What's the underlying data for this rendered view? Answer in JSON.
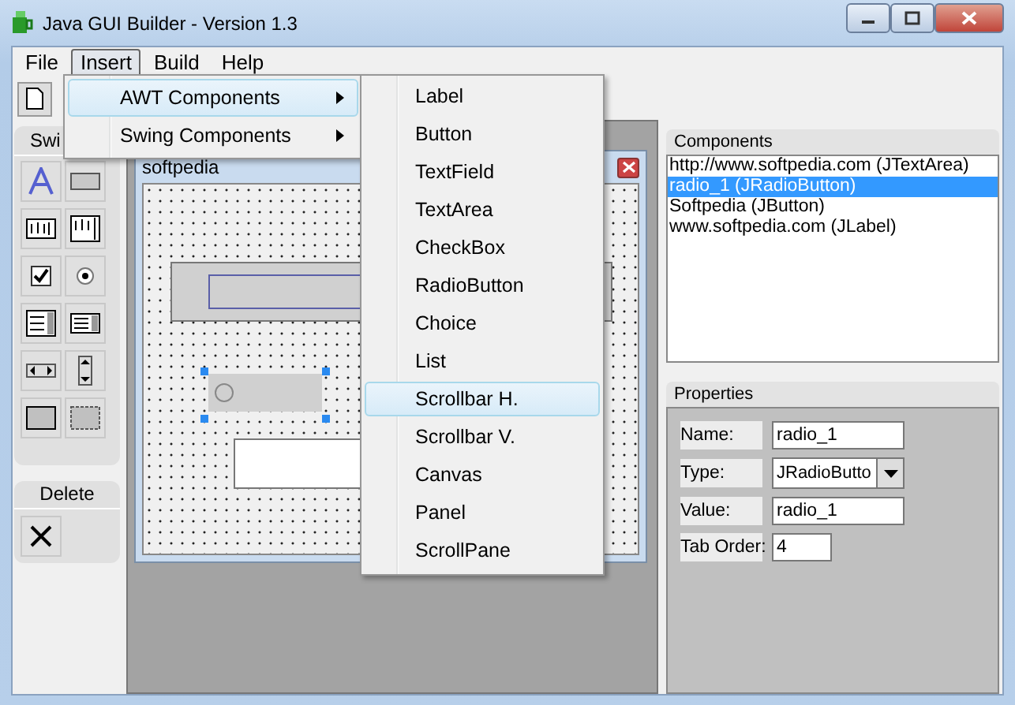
{
  "window": {
    "title": "Java GUI Builder - Version 1.3"
  },
  "menu_bar": [
    {
      "label": "File",
      "selected": false
    },
    {
      "label": "Insert",
      "selected": true
    },
    {
      "label": "Build",
      "selected": false
    },
    {
      "label": "Help",
      "selected": false
    }
  ],
  "insert_menu": [
    {
      "label": "AWT Components",
      "selected": true
    },
    {
      "label": "Swing Components",
      "selected": false
    }
  ],
  "awt_submenu": [
    {
      "label": "Label",
      "selected": false
    },
    {
      "label": "Button",
      "selected": false
    },
    {
      "label": "TextField",
      "selected": false
    },
    {
      "label": "TextArea",
      "selected": false
    },
    {
      "label": "CheckBox",
      "selected": false
    },
    {
      "label": "RadioButton",
      "selected": false
    },
    {
      "label": "Choice",
      "selected": false
    },
    {
      "label": "List",
      "selected": false
    },
    {
      "label": "Scrollbar H.",
      "selected": true
    },
    {
      "label": "Scrollbar V.",
      "selected": false
    },
    {
      "label": "Canvas",
      "selected": false
    },
    {
      "label": "Panel",
      "selected": false
    },
    {
      "label": "ScrollPane",
      "selected": false
    }
  ],
  "palette": {
    "tab": "Swi",
    "delete_title": "Delete"
  },
  "form_window": {
    "title": "softpedia"
  },
  "components": {
    "title": "Components",
    "items": [
      {
        "label": "http://www.softpedia.com (JTextArea)",
        "selected": false
      },
      {
        "label": "radio_1 (JRadioButton)",
        "selected": true
      },
      {
        "label": "Softpedia (JButton)",
        "selected": false
      },
      {
        "label": "www.softpedia.com (JLabel)",
        "selected": false
      }
    ]
  },
  "properties": {
    "title": "Properties",
    "fields": [
      {
        "kind": "text",
        "label": "Name:",
        "value": "radio_1"
      },
      {
        "kind": "dropdown",
        "label": "Type:",
        "value": "JRadioButto"
      },
      {
        "kind": "text",
        "label": "Value:",
        "value": "radio_1"
      },
      {
        "kind": "short",
        "label": "Tab Order:",
        "value": "4"
      }
    ]
  }
}
